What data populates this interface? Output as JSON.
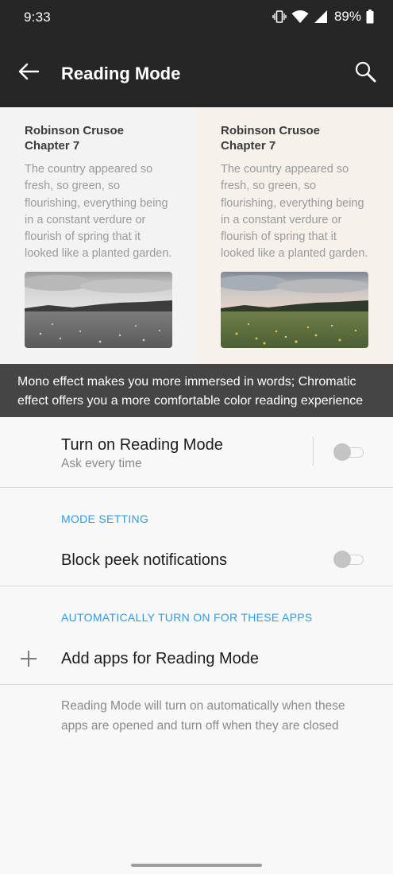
{
  "status_bar": {
    "time": "9:33",
    "battery_percent": "89%",
    "icons": [
      "vibrate-icon",
      "wifi-icon",
      "signal-icon",
      "battery-icon"
    ]
  },
  "app_bar": {
    "title": "Reading Mode",
    "back_icon": "back-arrow-icon",
    "search_icon": "search-icon"
  },
  "preview": {
    "mono": {
      "book": "Robinson Crusoe",
      "chapter": "Chapter 7",
      "excerpt": "The country appeared so fresh, so green, so flourishing, everything being in a constant verdure or flourish of spring that it looked like a planted garden."
    },
    "color": {
      "book": "Robinson Crusoe",
      "chapter": "Chapter 7",
      "excerpt": "The country appeared so fresh, so green, so flourishing, everything being in a constant verdure or flourish of spring that it looked like a planted garden."
    },
    "caption": "Mono effect makes you more immersed in words; Chromatic effect offers you a more comfortable color reading experience"
  },
  "settings": {
    "reading_mode": {
      "label": "Turn on Reading Mode",
      "sub": "Ask every time",
      "enabled": false
    },
    "mode_setting_header": "MODE SETTING",
    "block_peek": {
      "label": "Block peek notifications",
      "enabled": false
    },
    "auto_apps_header": "AUTOMATICALLY TURN ON FOR THESE APPS",
    "add_apps_label": "Add apps for Reading Mode",
    "footer_note": "Reading Mode will turn on automatically when these apps are opened and turn off when they are closed"
  },
  "colors": {
    "app_bar": "#262626",
    "accent": "#2f9be6",
    "caption_bg": "#454545"
  }
}
